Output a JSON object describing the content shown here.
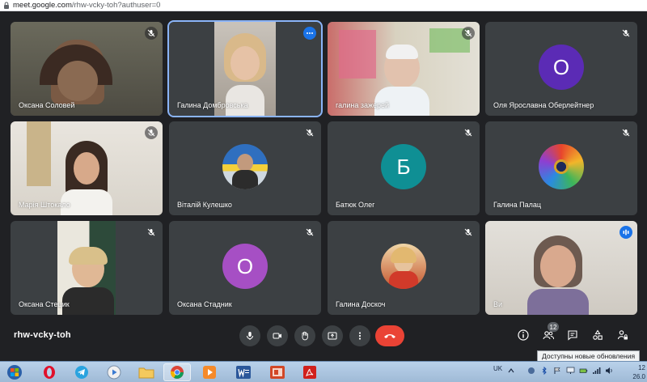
{
  "browser": {
    "url_host": "meet.google.com",
    "url_path": "/rhw-vcky-toh?authuser=0"
  },
  "tiles": [
    {
      "name": "Оксана Соловей"
    },
    {
      "name": "Галина Домбровська"
    },
    {
      "name": "галина зажерей"
    },
    {
      "name": "Оля Ярославна Оберлейтнер",
      "initial": "О",
      "color": "#5b2bb5"
    },
    {
      "name": "Марія Штокало"
    },
    {
      "name": "Віталій Кулешко"
    },
    {
      "name": "Батюк Олег",
      "initial": "Б",
      "color": "#0f8f94"
    },
    {
      "name": "Галина Палац"
    },
    {
      "name": "Оксана Стецик"
    },
    {
      "name": "Оксана Стадник",
      "initial": "О",
      "color": "#a64fc4"
    },
    {
      "name": "Галина Доскоч"
    },
    {
      "name": "Ви"
    }
  ],
  "controls": {
    "meeting_code": "rhw-vcky-toh",
    "participants_count": "12",
    "tooltip": "Доступны новые обновления"
  },
  "taskbar": {
    "lang": "UK",
    "time": "12",
    "date": "26.0"
  },
  "colors": {
    "hangup": "#ea4335",
    "accent": "#1a73e8",
    "tile_bg": "#3c4043",
    "page_bg": "#202124"
  }
}
